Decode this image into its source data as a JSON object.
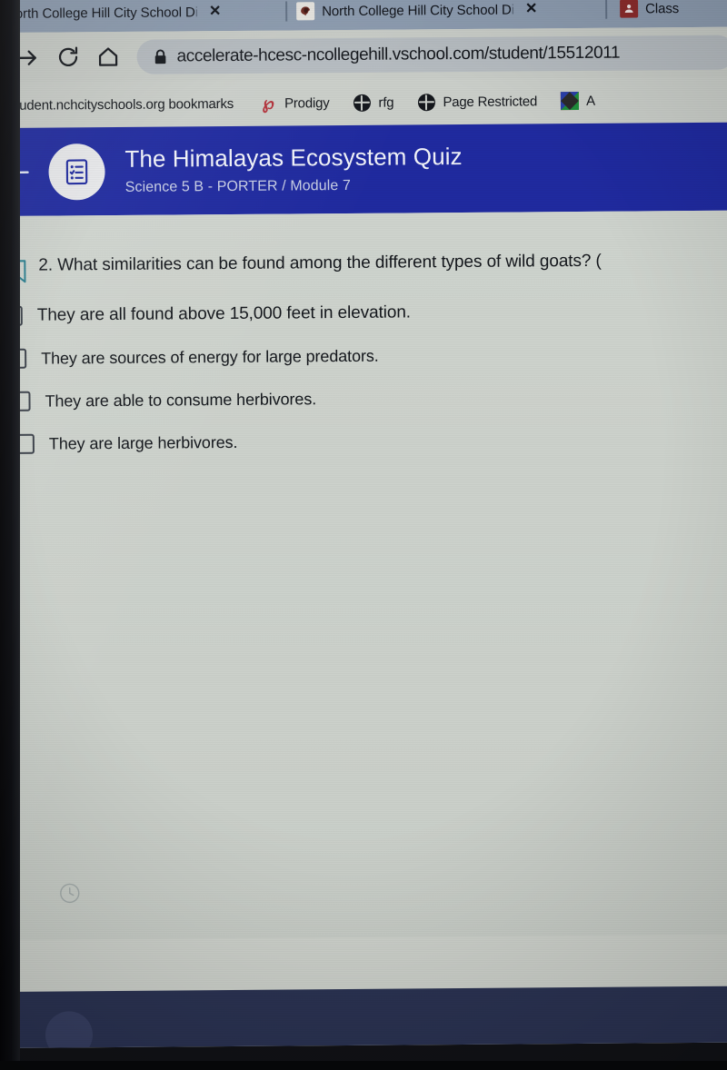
{
  "browser": {
    "tabs": [
      {
        "title": "North College Hill City School D",
        "title_faded": "i",
        "close_label": "✕",
        "favicon": "none"
      },
      {
        "title": "North College Hill City School D",
        "title_faded": "i",
        "close_label": "✕",
        "favicon": "spartan-helmet-favicon"
      },
      {
        "title": "Class",
        "title_faded": "",
        "close_label": "",
        "favicon": "google-classroom-favicon"
      }
    ],
    "toolbar": {
      "forward_icon": "forward-arrow-icon",
      "reload_icon": "reload-icon",
      "home_icon": "home-icon",
      "lock_icon": "lock-icon",
      "url": "accelerate-hcesc-ncollegehill.vschool.com/student/15512011"
    },
    "bookmarks": [
      {
        "label": "student.nchcityschools.org bookmarks",
        "icon": "folder-icon"
      },
      {
        "label": "Prodigy",
        "icon": "prodigy-icon"
      },
      {
        "label": "rfg",
        "icon": "globe-icon"
      },
      {
        "label": "Page Restricted",
        "icon": "globe-icon"
      },
      {
        "label": "A",
        "icon": "color-tile-icon"
      }
    ]
  },
  "app_header": {
    "back_icon": "back-arrow-icon",
    "avatar_icon": "quiz-clipboard-icon",
    "title": "The Himalayas Ecosystem Quiz",
    "subtitle": "Science 5 B - PORTER / Module 7",
    "accent_color": "#1f2aa0"
  },
  "quiz": {
    "bookmark_icon": "bookmark-flag-icon",
    "question_number": "2.",
    "question_text": "2. What similarities can be found among the different types of wild goats?  (",
    "options": [
      {
        "label": "They are all found above 15,000 feet in elevation.",
        "checked": false
      },
      {
        "label": "They are sources of energy for large predators.",
        "checked": false
      },
      {
        "label": "They are able to consume herbivores.",
        "checked": false
      },
      {
        "label": "They are large herbivores.",
        "checked": false
      }
    ],
    "timer_icon": "clock-icon"
  },
  "colors": {
    "header_blue": "#1f2aa0",
    "page_background": "#cdd2cc",
    "tabstrip": "#8d9cb0",
    "toolbar": "#c9cdc8",
    "bookmark_icon_teal": "#2a7f8f",
    "os_bar": "#2b3353"
  }
}
